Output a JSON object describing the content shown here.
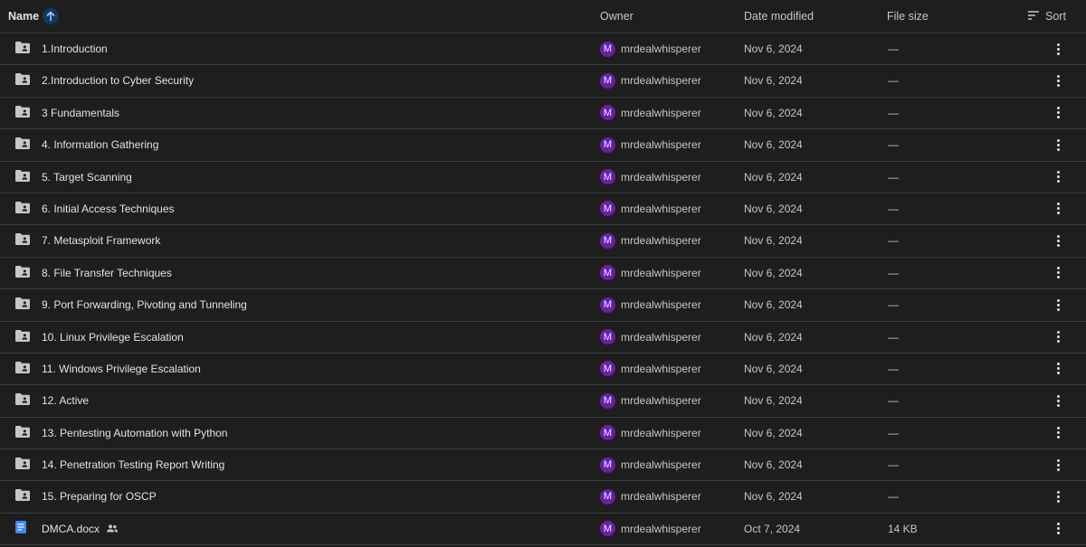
{
  "header": {
    "name": "Name",
    "owner": "Owner",
    "date_modified": "Date modified",
    "file_size": "File size",
    "sort": "Sort"
  },
  "rows": [
    {
      "name": "1.Introduction",
      "owner": "mrdealwhisperer",
      "owner_initial": "M",
      "date": "Nov 6, 2024",
      "size": "—",
      "type": "shared-folder"
    },
    {
      "name": "2.Introduction to Cyber Security",
      "owner": "mrdealwhisperer",
      "owner_initial": "M",
      "date": "Nov 6, 2024",
      "size": "—",
      "type": "shared-folder"
    },
    {
      "name": "3 Fundamentals",
      "owner": "mrdealwhisperer",
      "owner_initial": "M",
      "date": "Nov 6, 2024",
      "size": "—",
      "type": "shared-folder"
    },
    {
      "name": "4. Information Gathering",
      "owner": "mrdealwhisperer",
      "owner_initial": "M",
      "date": "Nov 6, 2024",
      "size": "—",
      "type": "shared-folder"
    },
    {
      "name": "5. Target Scanning",
      "owner": "mrdealwhisperer",
      "owner_initial": "M",
      "date": "Nov 6, 2024",
      "size": "—",
      "type": "shared-folder"
    },
    {
      "name": "6. Initial Access Techniques",
      "owner": "mrdealwhisperer",
      "owner_initial": "M",
      "date": "Nov 6, 2024",
      "size": "—",
      "type": "shared-folder"
    },
    {
      "name": "7. Metasploit Framework",
      "owner": "mrdealwhisperer",
      "owner_initial": "M",
      "date": "Nov 6, 2024",
      "size": "—",
      "type": "shared-folder"
    },
    {
      "name": "8. File Transfer Techniques",
      "owner": "mrdealwhisperer",
      "owner_initial": "M",
      "date": "Nov 6, 2024",
      "size": "—",
      "type": "shared-folder"
    },
    {
      "name": "9. Port Forwarding, Pivoting and Tunneling",
      "owner": "mrdealwhisperer",
      "owner_initial": "M",
      "date": "Nov 6, 2024",
      "size": "—",
      "type": "shared-folder"
    },
    {
      "name": "10. Linux Privilege Escalation",
      "owner": "mrdealwhisperer",
      "owner_initial": "M",
      "date": "Nov 6, 2024",
      "size": "—",
      "type": "shared-folder"
    },
    {
      "name": "11. Windows Privilege Escalation",
      "owner": "mrdealwhisperer",
      "owner_initial": "M",
      "date": "Nov 6, 2024",
      "size": "—",
      "type": "shared-folder"
    },
    {
      "name": "12. Active",
      "owner": "mrdealwhisperer",
      "owner_initial": "M",
      "date": "Nov 6, 2024",
      "size": "—",
      "type": "shared-folder"
    },
    {
      "name": "13. Pentesting Automation with Python",
      "owner": "mrdealwhisperer",
      "owner_initial": "M",
      "date": "Nov 6, 2024",
      "size": "—",
      "type": "shared-folder"
    },
    {
      "name": "14. Penetration Testing Report Writing",
      "owner": "mrdealwhisperer",
      "owner_initial": "M",
      "date": "Nov 6, 2024",
      "size": "—",
      "type": "shared-folder"
    },
    {
      "name": "15. Preparing for OSCP",
      "owner": "mrdealwhisperer",
      "owner_initial": "M",
      "date": "Nov 6, 2024",
      "size": "—",
      "type": "shared-folder"
    },
    {
      "name": "DMCA.docx",
      "owner": "mrdealwhisperer",
      "owner_initial": "M",
      "date": "Oct 7, 2024",
      "size": "14 KB",
      "type": "docx",
      "shared": true
    }
  ],
  "colors": {
    "background": "#1e1e1e",
    "divider": "#3c3c3c",
    "avatar": "#6a1fa8",
    "docx_icon": "#4285f4",
    "sort_badge": "#0e3a5e",
    "sort_arrow": "#a8c7fa"
  },
  "icons": {
    "shared_folder": "shared-folder-icon",
    "docx": "docs-file-icon",
    "shared": "people-icon",
    "sort_direction": "arrow-up-icon",
    "sort": "sort-lines-icon",
    "row_menu": "more-vert-icon"
  }
}
